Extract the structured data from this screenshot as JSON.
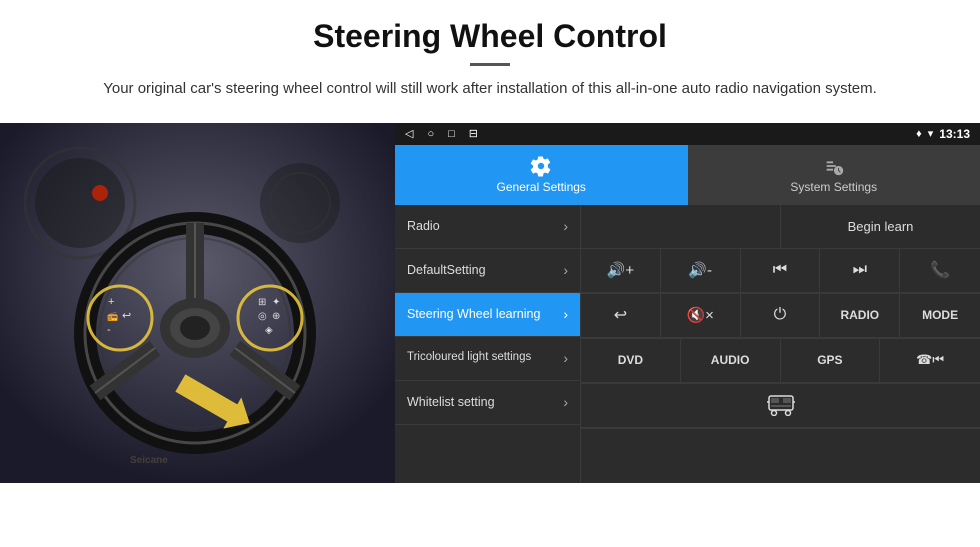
{
  "header": {
    "title": "Steering Wheel Control",
    "subtitle": "Your original car's steering wheel control will still work after installation of this all-in-one auto radio navigation system."
  },
  "android_screen": {
    "status_bar": {
      "location_icon": "♦",
      "wifi_icon": "▾",
      "time": "13:13"
    },
    "nav_icons": [
      "◁",
      "○",
      "□",
      "⊟"
    ],
    "tabs": [
      {
        "label": "General Settings",
        "active": true
      },
      {
        "label": "System Settings",
        "active": false
      }
    ],
    "menu_items": [
      {
        "label": "Radio",
        "active": false
      },
      {
        "label": "DefaultSetting",
        "active": false
      },
      {
        "label": "Steering Wheel learning",
        "active": true
      },
      {
        "label": "Tricoloured light settings",
        "active": false
      },
      {
        "label": "Whitelist setting",
        "active": false
      }
    ],
    "begin_learn_btn": "Begin learn",
    "control_buttons_row1": [
      {
        "label": "🔇+",
        "icon": "vol-up"
      },
      {
        "label": "🔇-",
        "icon": "vol-down"
      },
      {
        "label": "⏮",
        "icon": "prev"
      },
      {
        "label": "⏭",
        "icon": "next"
      },
      {
        "label": "📞",
        "icon": "phone"
      }
    ],
    "control_buttons_row2": [
      {
        "label": "↩",
        "icon": "return"
      },
      {
        "label": "🔇×",
        "icon": "mute"
      },
      {
        "label": "⏻",
        "icon": "power"
      },
      {
        "label": "RADIO",
        "icon": "radio"
      },
      {
        "label": "MODE",
        "icon": "mode"
      }
    ],
    "control_buttons_row3": [
      {
        "label": "DVD",
        "icon": "dvd"
      },
      {
        "label": "AUDIO",
        "icon": "audio"
      },
      {
        "label": "GPS",
        "icon": "gps"
      },
      {
        "label": "⊞⏮",
        "icon": "navi-prev"
      }
    ],
    "control_buttons_row4": [
      {
        "label": "🚌",
        "icon": "bus"
      }
    ]
  }
}
